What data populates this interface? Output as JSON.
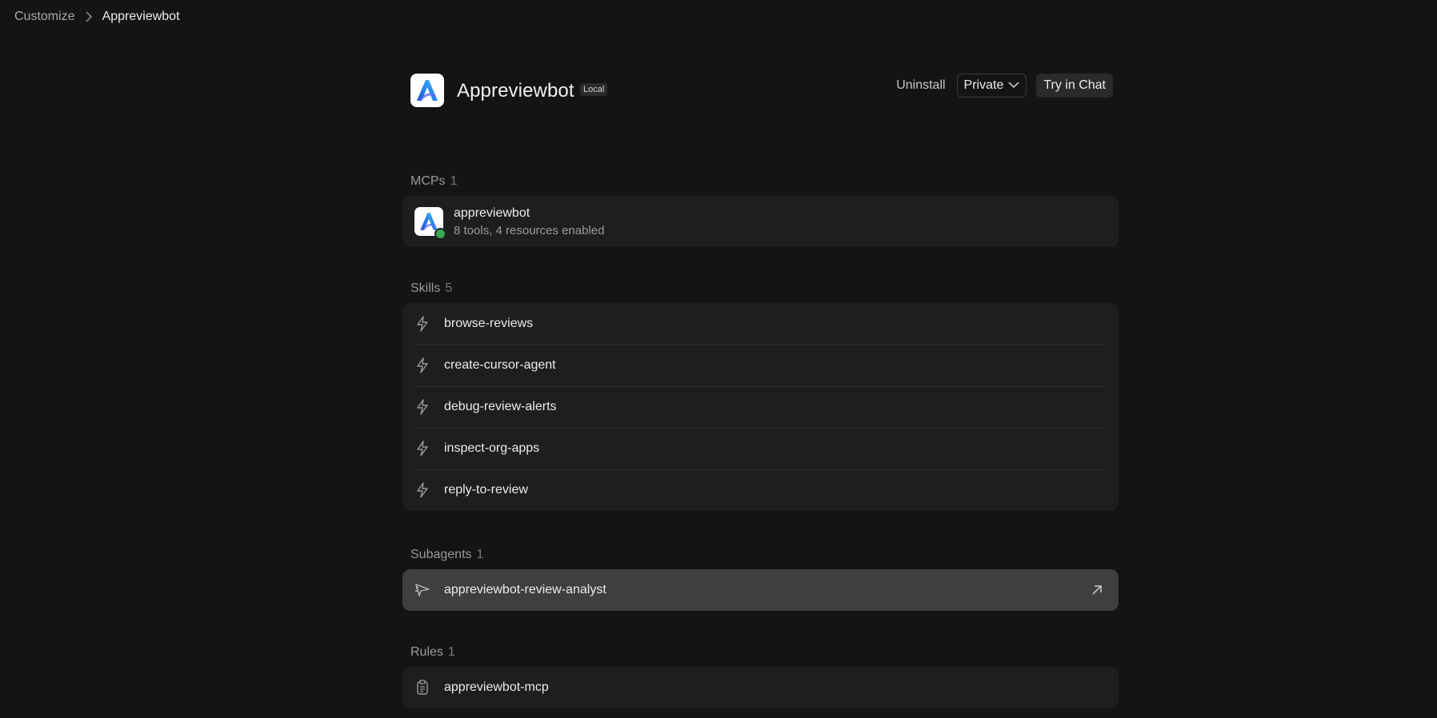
{
  "breadcrumb": {
    "parent": "Customize",
    "current": "Appreviewbot"
  },
  "header": {
    "title": "Appreviewbot",
    "badge": "Local",
    "logo_icon": "appreviewbot-logo",
    "uninstall_label": "Uninstall",
    "visibility_value": "Private",
    "try_label": "Try in Chat"
  },
  "mcps": {
    "title": "MCPs",
    "count": "1",
    "items": [
      {
        "name": "appreviewbot",
        "subtitle": "8 tools, 4 resources enabled",
        "status_color": "#34a853"
      }
    ]
  },
  "skills": {
    "title": "Skills",
    "count": "5",
    "items": [
      {
        "label": "browse-reviews"
      },
      {
        "label": "create-cursor-agent"
      },
      {
        "label": "debug-review-alerts"
      },
      {
        "label": "inspect-org-apps"
      },
      {
        "label": "reply-to-review"
      }
    ]
  },
  "subagents": {
    "title": "Subagents",
    "count": "1",
    "items": [
      {
        "label": "appreviewbot-review-analyst"
      }
    ]
  },
  "rules": {
    "title": "Rules",
    "count": "1",
    "items": [
      {
        "label": "appreviewbot-mcp"
      }
    ]
  },
  "colors": {
    "background": "#141414",
    "card": "#1e1e1e",
    "card_highlight": "#3f3f3f",
    "status_online": "#34a853",
    "logo_gradient_start": "#3b82f6",
    "logo_gradient_end": "#22d3ee"
  }
}
